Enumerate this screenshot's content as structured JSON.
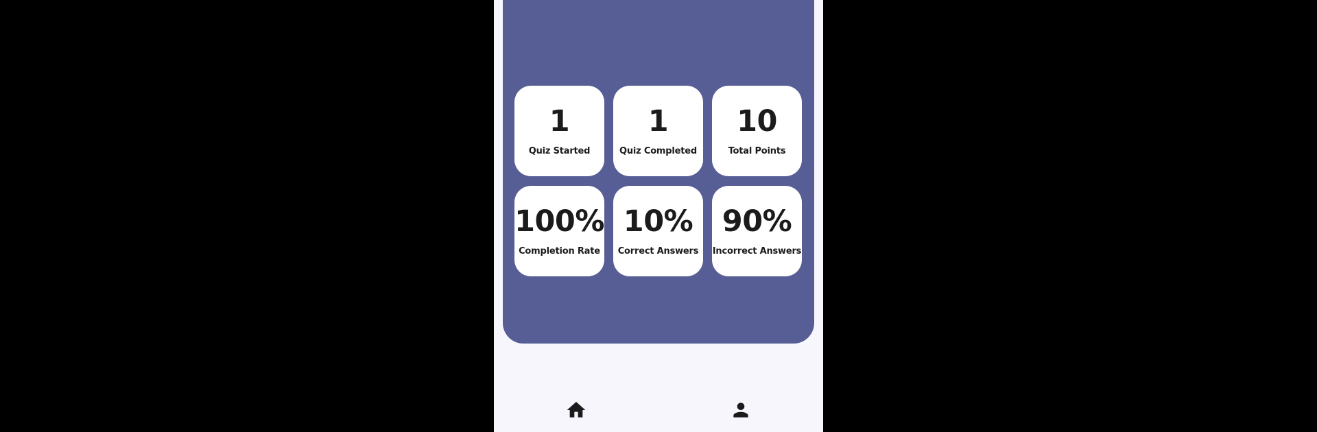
{
  "stats": {
    "row1": [
      {
        "value": "1",
        "label": "Quiz Started"
      },
      {
        "value": "1",
        "label": "Quiz Completed"
      },
      {
        "value": "10",
        "label": "Total Points"
      }
    ],
    "row2": [
      {
        "value": "100%",
        "label": "Completion Rate"
      },
      {
        "value": "10%",
        "label": "Correct Answers"
      },
      {
        "value": "90%",
        "label": "Incorrect Answers"
      }
    ]
  },
  "nav": {
    "items": [
      {
        "icon": "home-icon"
      },
      {
        "icon": "person-icon"
      }
    ]
  },
  "colors": {
    "panel": "#575E95",
    "card": "#FFFFFF",
    "background": "#F8F6FD",
    "text": "#1B1B1B"
  }
}
